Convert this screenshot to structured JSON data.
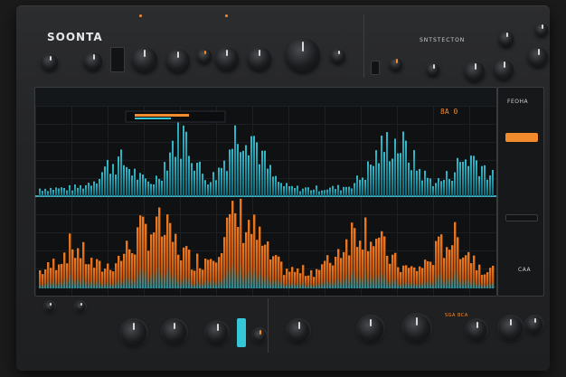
{
  "device": {
    "brand": "SOONTA",
    "section_title": "SNTSTECTON",
    "hud_readout": "8A 0",
    "side_title": "FEOHA",
    "side_value": "CAA",
    "bottom_badge": "SGA BCA"
  },
  "colors": {
    "accent": "#f28a2e",
    "wave_top": "#35c6d8",
    "wave_bottom": "#f07a20"
  },
  "icons": {
    "knob": "rotary-knob-icon",
    "led": "led-indicator-icon"
  }
}
